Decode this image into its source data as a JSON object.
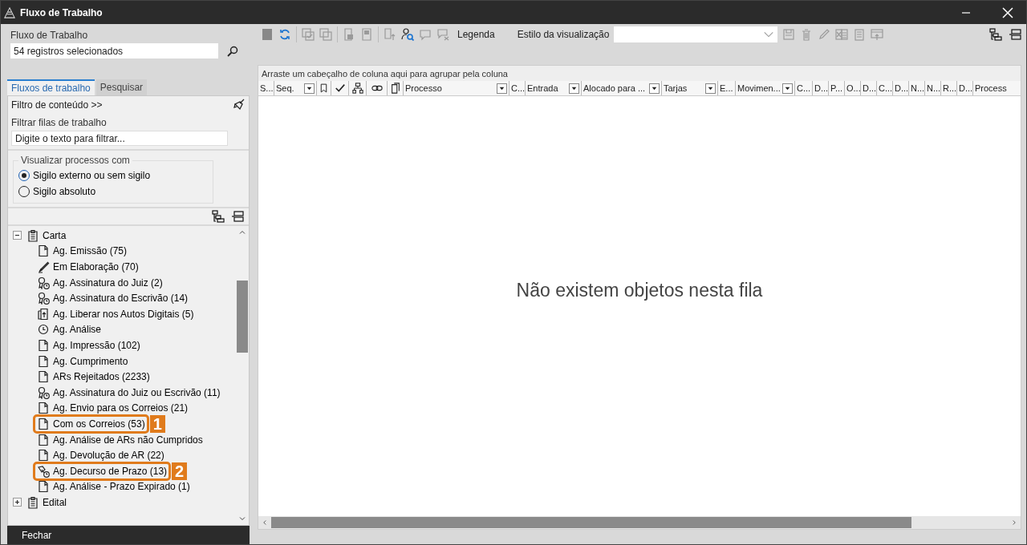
{
  "window": {
    "title": "Fluxo de Trabalho"
  },
  "workflow": {
    "label": "Fluxo de Trabalho",
    "value": "54 registros selecionados"
  },
  "tabs": [
    {
      "label": "Fluxos de trabalho",
      "selected": true
    },
    {
      "label": "Pesquisar",
      "selected": false
    }
  ],
  "content_filter": {
    "label": "Filtro de conteúdo >>"
  },
  "queue_filter": {
    "label": "Filtrar filas de trabalho",
    "value": "Digite o texto para filtrar..."
  },
  "visibility": {
    "legend": "Visualizar processos com",
    "options": [
      {
        "label": "Sigilo externo ou sem sigilo",
        "selected": true
      },
      {
        "label": "Sigilo absoluto",
        "selected": false
      }
    ]
  },
  "tree": [
    {
      "label": "Carta",
      "expanded": true,
      "children": [
        {
          "label": "Ag. Emissão (75)",
          "kind": "doc"
        },
        {
          "label": "Em Elaboração (70)",
          "kind": "pen"
        },
        {
          "label": "Ag. Assinatura do Juiz (2)",
          "kind": "seal"
        },
        {
          "label": "Ag. Assinatura do Escrivão (14)",
          "kind": "seal"
        },
        {
          "label": "Ag. Liberar nos Autos Digitais (5)",
          "kind": "upload"
        },
        {
          "label": "Ag. Análise",
          "kind": "clock"
        },
        {
          "label": "Ag. Impressão (102)",
          "kind": "doc"
        },
        {
          "label": "Ag. Cumprimento",
          "kind": "doc"
        },
        {
          "label": "ARs Rejeitados (2233)",
          "kind": "doc"
        },
        {
          "label": "Ag. Assinatura do Juiz ou Escrivão (11)",
          "kind": "seal"
        },
        {
          "label": "Ag. Envio para os Correios (21)",
          "kind": "doc"
        },
        {
          "label": "Com os Correios (53)",
          "kind": "doc",
          "callout": "1"
        },
        {
          "label": "Ag. Análise de ARs não Cumpridos",
          "kind": "doc"
        },
        {
          "label": "Ag. Devolução de AR (22)",
          "kind": "doc"
        },
        {
          "label": "Ag. Decurso de Prazo (13)",
          "kind": "stamp",
          "callout": "2"
        },
        {
          "label": "Ag. Análise - Prazo Expirado (1)",
          "kind": "doc"
        }
      ]
    },
    {
      "label": "Edital",
      "expanded": false
    }
  ],
  "close_button": "Fechar",
  "toolbar": {
    "legend": "Legenda",
    "view_style_label": "Estilo da visualização"
  },
  "grid": {
    "group_hint": "Arraste um cabeçalho de coluna aqui para agrupar pela coluna",
    "columns": [
      {
        "kind": "text",
        "label": "S...",
        "filter": false
      },
      {
        "kind": "text",
        "label": "Seq.",
        "filter": true
      },
      {
        "kind": "icon"
      },
      {
        "kind": "icon"
      },
      {
        "kind": "icon"
      },
      {
        "kind": "icon"
      },
      {
        "kind": "icon"
      },
      {
        "kind": "text",
        "label": "Processo",
        "filter": true
      },
      {
        "kind": "text",
        "label": "C...",
        "filter": false
      },
      {
        "kind": "text",
        "label": "Entrada",
        "filter": true
      },
      {
        "kind": "text",
        "label": "Alocado para ...",
        "filter": true
      },
      {
        "kind": "text",
        "label": "Tarjas",
        "filter": true
      },
      {
        "kind": "text",
        "label": "E...",
        "filter": false
      },
      {
        "kind": "text",
        "label": "Movimen...",
        "filter": true
      },
      {
        "kind": "text",
        "label": "C...",
        "filter": false
      },
      {
        "kind": "text",
        "label": "D...",
        "filter": false
      },
      {
        "kind": "text",
        "label": "P...",
        "filter": false
      },
      {
        "kind": "text",
        "label": "O...",
        "filter": false
      },
      {
        "kind": "text",
        "label": "D...",
        "filter": false
      },
      {
        "kind": "text",
        "label": "C...",
        "filter": false
      },
      {
        "kind": "text",
        "label": "D...",
        "filter": false
      },
      {
        "kind": "text",
        "label": "N...",
        "filter": false
      },
      {
        "kind": "text",
        "label": "N...",
        "filter": false
      },
      {
        "kind": "text",
        "label": "R...",
        "filter": false
      },
      {
        "kind": "text",
        "label": "D...",
        "filter": false
      },
      {
        "kind": "text",
        "label": "Process",
        "filter": false
      }
    ],
    "empty_message": "Não existem objetos nesta fila"
  }
}
